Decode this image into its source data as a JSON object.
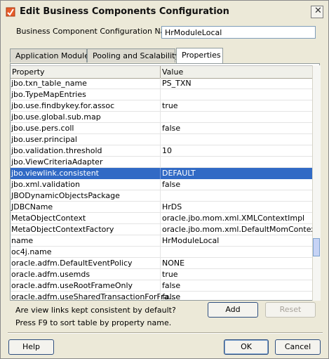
{
  "window": {
    "title": "Edit Business Components Configuration"
  },
  "config": {
    "label": "Business Component Configuration Name:",
    "value": "HrModuleLocal"
  },
  "tabs": [
    {
      "label": "Application Module"
    },
    {
      "label": "Pooling and Scalability"
    },
    {
      "label": "Properties"
    }
  ],
  "table": {
    "columns": [
      "Property",
      "Value"
    ],
    "rows": [
      {
        "key": "jbo.txn_table_name",
        "value": "PS_TXN"
      },
      {
        "key": "jbo.TypeMapEntries",
        "value": ""
      },
      {
        "key": "jbo.use.findbykey.for.assoc",
        "value": "true"
      },
      {
        "key": "jbo.use.global.sub.map",
        "value": ""
      },
      {
        "key": "jbo.use.pers.coll",
        "value": "false"
      },
      {
        "key": "jbo.user.principal",
        "value": ""
      },
      {
        "key": "jbo.validation.threshold",
        "value": "10"
      },
      {
        "key": "jbo.ViewCriteriaAdapter",
        "value": ""
      },
      {
        "key": "jbo.viewlink.consistent",
        "value": "DEFAULT"
      },
      {
        "key": "jbo.xml.validation",
        "value": "false"
      },
      {
        "key": "JBODynamicObjectsPackage",
        "value": ""
      },
      {
        "key": "JDBCName",
        "value": "HrDS"
      },
      {
        "key": "MetaObjectContext",
        "value": "oracle.jbo.mom.xml.XMLContextImpl"
      },
      {
        "key": "MetaObjectContextFactory",
        "value": "oracle.jbo.mom.xml.DefaultMomContextF..."
      },
      {
        "key": "name",
        "value": "HrModuleLocal"
      },
      {
        "key": "oc4j.name",
        "value": ""
      },
      {
        "key": "oracle.adfm.DefaultEventPolicy",
        "value": "NONE"
      },
      {
        "key": "oracle.adfm.usemds",
        "value": "true"
      },
      {
        "key": "oracle.adfm.useRootFrameOnly",
        "value": "false"
      },
      {
        "key": "oracle.adfm.useSharedTransactionForFra...",
        "value": "false"
      }
    ]
  },
  "description": "Are view links kept consistent by default?",
  "hint": "Press F9 to sort table by property name.",
  "buttons": {
    "add": "Add",
    "reset": "Reset",
    "help": "Help",
    "ok": "OK",
    "cancel": "Cancel"
  },
  "colors": {
    "selection": "#316ac5",
    "dialog_bg": "#ece9d8"
  }
}
